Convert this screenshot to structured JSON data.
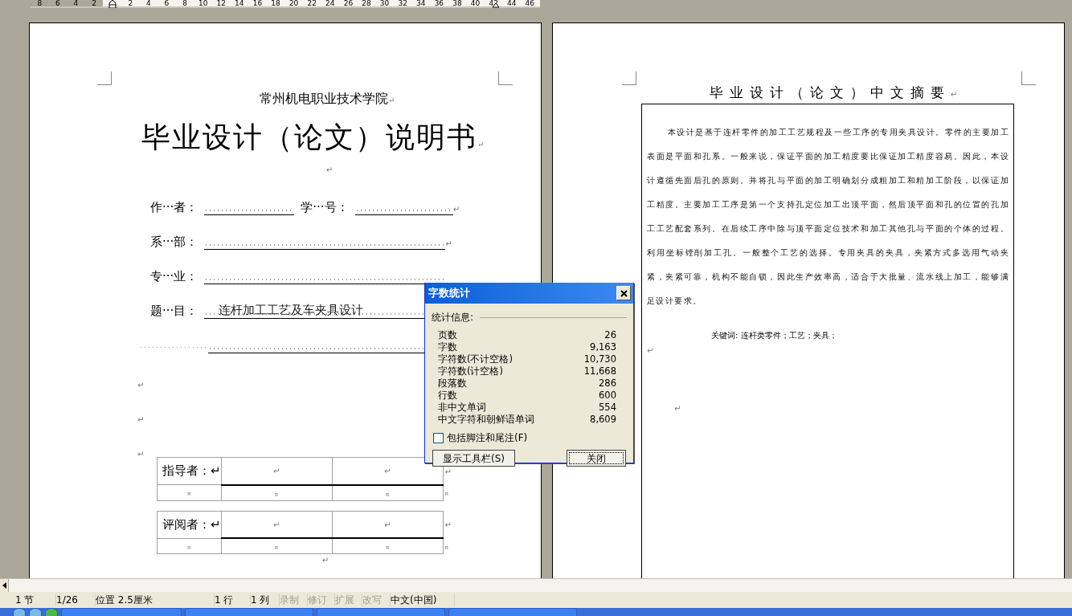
{
  "ruler": {
    "left_ticks": [
      "8",
      "6",
      "4",
      "2"
    ],
    "right_ticks": [
      "2",
      "4",
      "6",
      "8",
      "10",
      "12",
      "14",
      "16",
      "18",
      "20",
      "22",
      "24",
      "26",
      "28",
      "30",
      "32",
      "34",
      "36",
      "38",
      "40",
      "42",
      "44",
      "46"
    ]
  },
  "left_page": {
    "school": "常州机电职业技术学院",
    "school_mark": "↵",
    "title": "毕业设计（论文）说明书",
    "title_mark": "↵",
    "blank_mark": "↵",
    "form_rows": [
      {
        "fields": [
          {
            "label": "作···者："
          },
          {
            "label": "学···号："
          }
        ],
        "mark": "↵"
      },
      {
        "fields": [
          {
            "label": "系···部："
          }
        ],
        "mark": "↵"
      },
      {
        "fields": [
          {
            "label": "专···业："
          }
        ]
      },
      {
        "fields": [
          {
            "label": "题···目：",
            "value": "连杆加工工艺及车夹具设计"
          }
        ]
      },
      {
        "fields": [
          {
            "kind": "continuation"
          }
        ]
      }
    ],
    "blank_marks": [
      "↵",
      "↵",
      "↵"
    ],
    "tables": [
      {
        "rows": [
          {
            "cells": [
              "指导者：↵",
              "↵",
              "↵"
            ],
            "end": "↵"
          },
          {
            "cells": [
              "¤",
              "¤",
              "¤"
            ],
            "end": "¤"
          }
        ]
      },
      {
        "rows": [
          {
            "cells": [
              "评阅者：↵",
              "↵",
              "↵"
            ],
            "end": "↵"
          },
          {
            "cells": [
              "¤",
              "¤",
              "¤"
            ],
            "end": "¤"
          }
        ]
      }
    ],
    "end_mark": "↵"
  },
  "right_page": {
    "title": "毕业设计（论文）中文摘要",
    "title_mark": "↵",
    "abstract": "本设计是基于连杆零件的加工工艺规程及一些工序的专用夹具设计。零件的主要加工表面是平面和孔系。一般来说，保证平面的加工精度要比保证加工精度容易。因此，本设计遵循先面后孔的原则。并将孔与平面的加工明确划分成粗加工和精加工阶段，以保证加工精度。主要加工工序是第一个支持孔定位加工出顶平面，然后顶平面和孔的位置的孔加工工艺配套系列。在后续工序中除与顶平面定位技术和加工其他孔与平面的个体的过程。利用坐标镗削加工孔。一般整个工艺的选择。专用夹具的夹具，夹紧方式多选用气动夹紧，夹紧可靠，机构不能自锁，因此生产效率高，适合于大批量、流水线上加工，能够满足设计要求。",
    "keywords": "关键词: 连杆类零件；工艺；夹具；",
    "after_marks": [
      "↵",
      "↵"
    ]
  },
  "dialog": {
    "title": "字数统计",
    "group_label": "统计信息:",
    "stats": [
      {
        "label": "页数",
        "value": "26"
      },
      {
        "label": "字数",
        "value": "9,163"
      },
      {
        "label": "字符数(不计空格)",
        "value": "10,730"
      },
      {
        "label": "字符数(计空格)",
        "value": "11,668"
      },
      {
        "label": "段落数",
        "value": "286"
      },
      {
        "label": "行数",
        "value": "600"
      },
      {
        "label": "非中文单词",
        "value": "554"
      },
      {
        "label": "中文字符和朝鲜语单词",
        "value": "8,609"
      }
    ],
    "checkbox": {
      "label": "包括脚注和尾注(F)",
      "checked": false
    },
    "buttons": [
      {
        "label": "显示工具栏(S)",
        "default": false
      },
      {
        "label": "关闭",
        "default": true
      }
    ]
  },
  "status_bar": [
    {
      "text": "1 节",
      "disabled": false
    },
    {
      "text": "1/26",
      "disabled": false
    },
    {
      "text": "位置 2.5厘米",
      "disabled": false
    },
    {
      "text": "1 行",
      "disabled": false
    },
    {
      "text": "1 列",
      "disabled": false
    },
    {
      "text": "录制",
      "disabled": true
    },
    {
      "text": "修订",
      "disabled": true
    },
    {
      "text": "扩展",
      "disabled": true
    },
    {
      "text": "改写",
      "disabled": true
    },
    {
      "text": "中文(中国)",
      "disabled": false
    }
  ]
}
